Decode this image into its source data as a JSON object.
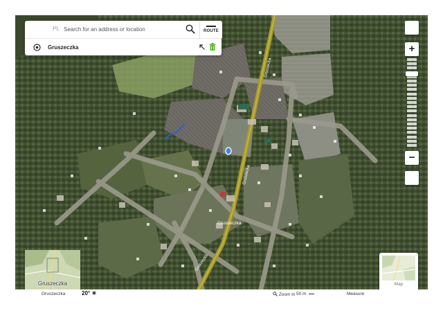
{
  "search": {
    "country": "PL",
    "placeholder": "Search for an address or location",
    "route_label": "ROUTE"
  },
  "place": {
    "name": "Gruszeczka"
  },
  "map": {
    "road_labels": [
      "Gruszecka",
      "Gruszecka",
      "Gruszecka"
    ],
    "village_label": "Gruszeczka"
  },
  "minimap": {
    "label": "Gruszeczka"
  },
  "map_type": {
    "label": "Map"
  },
  "bottom_bar": {
    "place": "Gruszeczka",
    "weather": "20°",
    "weather_icon": "sun-icon",
    "zoom_in": "Zoom in",
    "scale": "50 m",
    "measure": "Measure"
  },
  "zoom": {
    "level_fraction": 0.15
  },
  "colors": {
    "route_road": "#a79a2a",
    "user_mark": "#2a5ed8",
    "marker": "#3f86e0",
    "delete_icon": "#5fb528"
  }
}
